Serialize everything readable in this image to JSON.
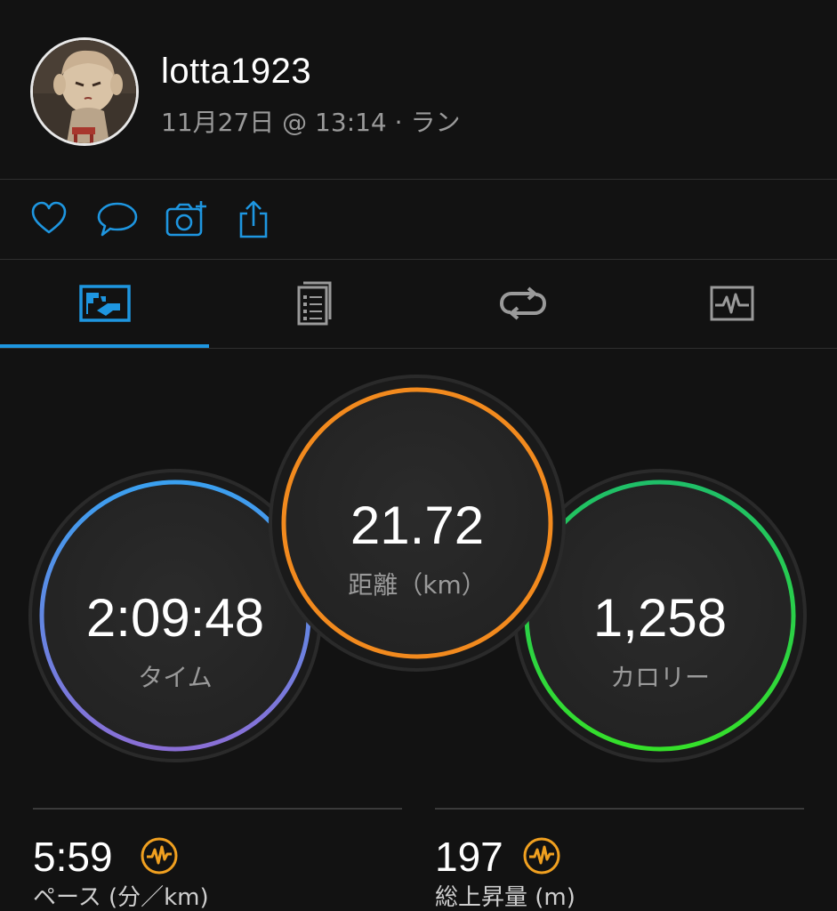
{
  "header": {
    "username": "lotta1923",
    "meta": "11月27日 @ 13:14 · ラン"
  },
  "actions": {
    "icons": [
      "heart-icon",
      "comment-icon",
      "add-photo-icon",
      "share-icon"
    ]
  },
  "tabs": {
    "active_index": 0,
    "icons": [
      "stats-map-icon",
      "details-list-icon",
      "laps-loop-icon",
      "chart-icon"
    ]
  },
  "colors": {
    "accent_blue": "#1e96e0",
    "time_ring_start": "#3aa0f0",
    "time_ring_end": "#8a6fd6",
    "distance_ring": "#f28a1e",
    "calorie_ring_start": "#1fbf68",
    "calorie_ring_end": "#35e02a",
    "stat_icon": "#f0a020"
  },
  "metrics": {
    "time": {
      "value": "2:09:48",
      "label": "タイム"
    },
    "distance": {
      "value": "21.72",
      "label": "距離（km）"
    },
    "calories": {
      "value": "1,258",
      "label": "カロリー"
    }
  },
  "stats": [
    {
      "value": "5:59",
      "label": "ペース (分／km)",
      "icon": "activity-pulse-icon"
    },
    {
      "value": "197",
      "label": "総上昇量 (m)",
      "icon": "activity-pulse-icon"
    }
  ]
}
